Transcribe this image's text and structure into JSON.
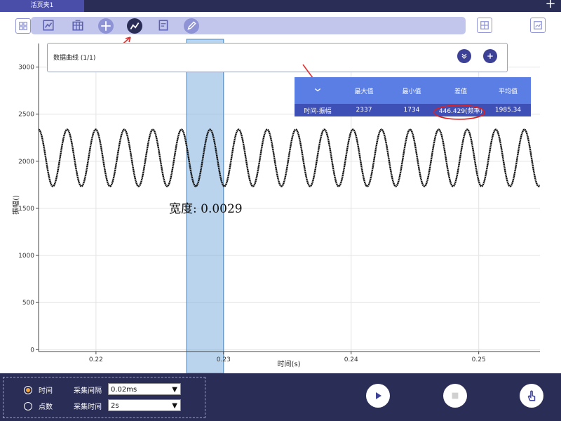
{
  "tab": {
    "label": "活页夹1"
  },
  "toolbar": {
    "buttons": [
      "grid-view",
      "chart-analysis",
      "data-table",
      "add-crosshair",
      "curve-fit",
      "export-report",
      "annotate"
    ],
    "active": "curve-fit"
  },
  "panel": {
    "title": "数据曲线 (1/1)"
  },
  "stats": {
    "headers": [
      "最大值",
      "最小值",
      "差值",
      "平均值"
    ],
    "row": {
      "name": "时间-振幅",
      "max": "2337",
      "min": "1734",
      "diff": "446.429(频率)",
      "avg": "1985.34"
    }
  },
  "width_label": "宽度: 0.0029",
  "chart_data": {
    "type": "line",
    "xlabel": "时间(s)",
    "ylabel": "振幅()",
    "xlim": [
      0.2155,
      0.2548
    ],
    "ylim": [
      -20,
      3250
    ],
    "x_ticks": [
      "0.22",
      "0.23",
      "0.24",
      "0.25"
    ],
    "y_ticks": [
      "0",
      "500",
      "1000",
      "1500",
      "2000",
      "2500",
      "3000"
    ],
    "series": [
      {
        "color": "#111111",
        "min": 1734,
        "max": 2337,
        "frequency_hz": 446.429
      }
    ],
    "selection": {
      "x_start": 0.2271,
      "x_end": 0.23
    },
    "grid": true
  },
  "config": {
    "mode_options": [
      "时间",
      "点数"
    ],
    "mode_selected": "时间",
    "interval_label": "采集间隔",
    "interval_value": "0.02ms",
    "duration_label": "采集时间",
    "duration_value": "2s"
  },
  "controls": [
    "play",
    "stop",
    "touch"
  ]
}
